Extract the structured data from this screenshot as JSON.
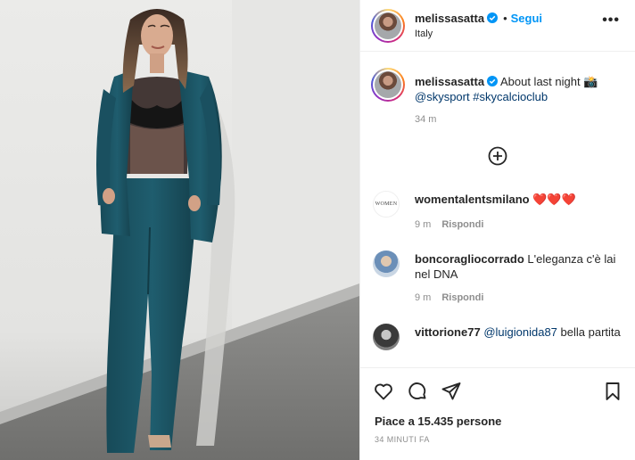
{
  "post": {
    "username": "melissasatta",
    "follow_label": "Segui",
    "location": "Italy",
    "more_label": "•••",
    "caption": {
      "username": "melissasatta",
      "text": "About last night 📸",
      "mention": "@skysport",
      "hashtag": "#skycalcioclub",
      "time": "34 m"
    },
    "comments": [
      {
        "username": "womentalentsmilano",
        "text": "❤️❤️❤️",
        "time": "9 m",
        "reply": "Rispondi",
        "avatar_label": "WOMEN"
      },
      {
        "username": "boncoragliocorrado",
        "text": "L'eleganza c'è lai nel DNA",
        "time": "9 m",
        "reply": "Rispondi"
      },
      {
        "username": "vittorione77",
        "mention": "@luigionida87",
        "text": "bella partita"
      }
    ],
    "likes_label": "Piace a 15.435 persone",
    "posted_ago": "34 MINUTI FA"
  },
  "colors": {
    "accent_blue": "#0095f6",
    "link_dark": "#00376b",
    "muted": "#8e8e8e",
    "suit_teal": "#1d5566"
  },
  "icons": [
    "verified-badge-icon",
    "more-options-icon",
    "load-more-comments-icon",
    "heart-icon",
    "comment-icon",
    "share-icon",
    "bookmark-icon"
  ]
}
